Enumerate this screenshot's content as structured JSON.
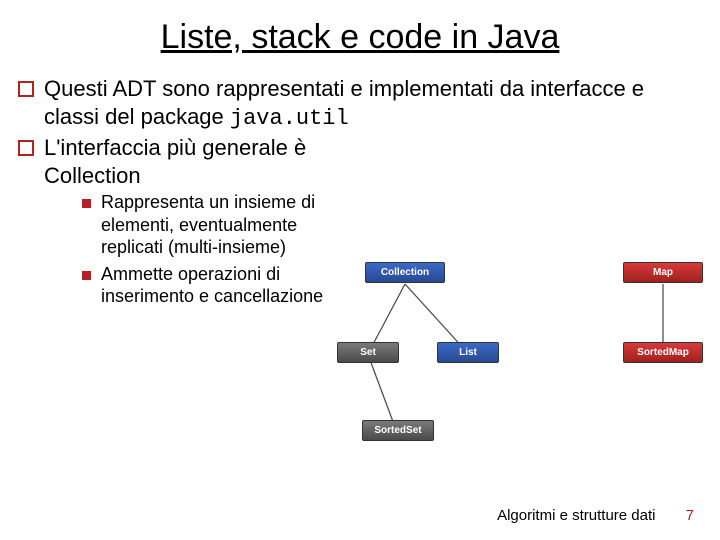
{
  "title": "Liste, stack e code in Java",
  "bullets": {
    "b1a_pre": "Questi ADT sono rappresentati e implementati da interfacce e classi del package ",
    "b1a_code": "java.util",
    "b1b": "L'interfaccia più generale è Collection",
    "b2a": "Rappresenta un insieme di elementi, eventualmente replicati (multi-insieme)",
    "b2b": "Ammette operazioni di inserimento e cancellazione"
  },
  "diagram": {
    "collection": "Collection",
    "map": "Map",
    "set": "Set",
    "list": "List",
    "sortedmap": "SortedMap",
    "sortedset": "SortedSet"
  },
  "footer": {
    "text": "Algoritmi e strutture dati",
    "page": "7"
  }
}
